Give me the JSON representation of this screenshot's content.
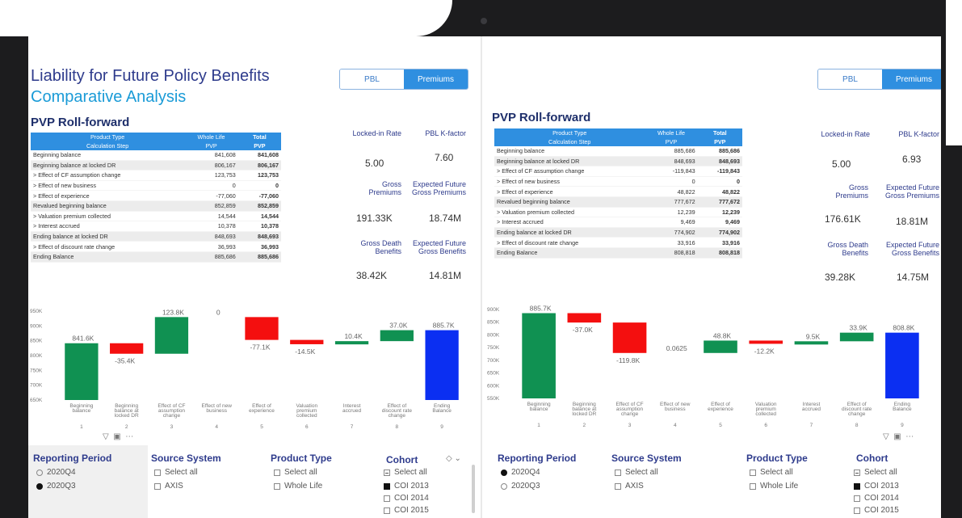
{
  "titles": {
    "main": "Liability for Future Policy Benefits",
    "sub": "Comparative Analysis",
    "section": "PVP Roll-forward"
  },
  "toggle": {
    "pbl": "PBL",
    "premiums": "Premiums"
  },
  "table_headers": {
    "product_type": "Product Type",
    "whole_life": "Whole Life",
    "total": "Total",
    "calc_step": "Calculation Step",
    "pvp": "PVP",
    "pvp_total": "PVP"
  },
  "left": {
    "rows": [
      {
        "label": "Beginning balance",
        "val": "841,608",
        "tot": "841,608"
      },
      {
        "label": "Beginning balance at locked DR",
        "val": "806,167",
        "tot": "806,167"
      },
      {
        "label": "> Effect of CF assumption change",
        "val": "123,753",
        "tot": "123,753"
      },
      {
        "label": "> Effect of new business",
        "val": "0",
        "tot": "0"
      },
      {
        "label": "> Effect of experience",
        "val": "-77,060",
        "tot": "-77,060"
      },
      {
        "label": "Revalued beginning balance",
        "val": "852,859",
        "tot": "852,859"
      },
      {
        "label": "> Valuation premium collected",
        "val": "14,544",
        "tot": "14,544"
      },
      {
        "label": "> Interest accrued",
        "val": "10,378",
        "tot": "10,378"
      },
      {
        "label": "Ending balance at locked DR",
        "val": "848,693",
        "tot": "848,693"
      },
      {
        "label": "> Effect of discount rate change",
        "val": "36,993",
        "tot": "36,993"
      },
      {
        "label": "Ending Balance",
        "val": "885,686",
        "tot": "885,686"
      }
    ],
    "kpis": {
      "locked_rate_label": "Locked-in Rate",
      "locked_rate": "5.00",
      "kfactor_label": "PBL K-factor",
      "kfactor": "7.60",
      "gross_prem_label": "Gross Premiums",
      "gross_prem": "191.33K",
      "exp_prem_label": "Expected Future Gross Premiums",
      "exp_prem": "18.74M",
      "gross_death_label": "Gross Death Benefits",
      "gross_death": "38.42K",
      "exp_ben_label": "Expected Future Gross Benefits",
      "exp_ben": "14.81M"
    },
    "filters": {
      "reporting_period": {
        "title": "Reporting Period",
        "options": [
          "2020Q4",
          "2020Q3"
        ]
      },
      "source_system": {
        "title": "Source System",
        "options": [
          "Select all",
          "AXIS"
        ]
      },
      "product_type": {
        "title": "Product Type",
        "options": [
          "Select all",
          "Whole Life"
        ]
      },
      "cohort": {
        "title": "Cohort",
        "options": [
          "Select all",
          "COI 2013",
          "COI 2014",
          "COI 2015"
        ]
      }
    }
  },
  "right": {
    "rows": [
      {
        "label": "Beginning balance",
        "val": "885,686",
        "tot": "885,686"
      },
      {
        "label": "Beginning balance at locked DR",
        "val": "848,693",
        "tot": "848,693"
      },
      {
        "label": "> Effect of CF assumption change",
        "val": "-119,843",
        "tot": "-119,843"
      },
      {
        "label": "> Effect of new business",
        "val": "0",
        "tot": "0"
      },
      {
        "label": "> Effect of experience",
        "val": "48,822",
        "tot": "48,822"
      },
      {
        "label": "Revalued beginning balance",
        "val": "777,672",
        "tot": "777,672"
      },
      {
        "label": "> Valuation premium collected",
        "val": "12,239",
        "tot": "12,239"
      },
      {
        "label": "> Interest accrued",
        "val": "9,469",
        "tot": "9,469"
      },
      {
        "label": "Ending balance at locked DR",
        "val": "774,902",
        "tot": "774,902"
      },
      {
        "label": "> Effect of discount rate change",
        "val": "33,916",
        "tot": "33,916"
      },
      {
        "label": "Ending Balance",
        "val": "808,818",
        "tot": "808,818"
      }
    ],
    "kpis": {
      "locked_rate_label": "Locked-in Rate",
      "locked_rate": "5.00",
      "kfactor_label": "PBL K-factor",
      "kfactor": "6.93",
      "gross_prem_label": "Gross Premiums",
      "gross_prem": "176.61K",
      "exp_prem_label": "Expected Future Gross Premiums",
      "exp_prem": "18.81M",
      "gross_death_label": "Gross Death Benefits",
      "gross_death": "39.28K",
      "exp_ben_label": "Expected Future Gross Benefits",
      "exp_ben": "14.75M"
    },
    "filters": {
      "reporting_period": {
        "title": "Reporting Period",
        "options": [
          "2020Q4",
          "2020Q3"
        ]
      },
      "source_system": {
        "title": "Source System",
        "options": [
          "Select all",
          "AXIS"
        ]
      },
      "product_type": {
        "title": "Product Type",
        "options": [
          "Select all",
          "Whole Life"
        ]
      },
      "cohort": {
        "title": "Cohort",
        "options": [
          "Select all",
          "COI 2013",
          "COI 2014",
          "COI 2015"
        ]
      }
    }
  },
  "colors": {
    "green": "#109152",
    "red": "#f40f0f",
    "blue": "#0b2ff2",
    "header": "#2f8fe0",
    "title": "#2e3b8c",
    "accent": "#1a9bd7"
  },
  "chart_data": [
    {
      "type": "bar",
      "title": "",
      "categories": [
        "Beginning balance",
        "Beginning balance at locked DR",
        "Effect of CF assumption change",
        "Effect of new business",
        "Effect of experience",
        "Valuation premium collected",
        "Interest accrued",
        "Effect of discount rate change",
        "Ending Balance"
      ],
      "tick_numbers": [
        "1",
        "2",
        "3",
        "4",
        "5",
        "6",
        "7",
        "8",
        "9"
      ],
      "y_ticks": [
        "950K",
        "900K",
        "850K",
        "800K",
        "750K",
        "700K",
        "650K"
      ],
      "ylim": [
        650000,
        950000
      ],
      "bars": [
        {
          "start": 650000,
          "end": 841608,
          "label": "841.6K",
          "color": "green"
        },
        {
          "start": 841608,
          "end": 806167,
          "label": "-35.4K",
          "color": "red"
        },
        {
          "start": 806167,
          "end": 929920,
          "label": "123.8K",
          "color": "green"
        },
        {
          "start": 929920,
          "end": 929920,
          "label": "0",
          "color": "none"
        },
        {
          "start": 929920,
          "end": 852859,
          "label": "-77.1K",
          "color": "red"
        },
        {
          "start": 852859,
          "end": 838315,
          "label": "-14.5K",
          "color": "red"
        },
        {
          "start": 838315,
          "end": 848693,
          "label": "10.4K",
          "color": "green"
        },
        {
          "start": 848693,
          "end": 885686,
          "label": "37.0K",
          "color": "green"
        },
        {
          "start": 650000,
          "end": 885686,
          "label": "885.7K",
          "color": "blue"
        }
      ]
    },
    {
      "type": "bar",
      "title": "",
      "categories": [
        "Beginning balance",
        "Beginning balance at locked DR",
        "Effect of CF assumption change",
        "Effect of new business",
        "Effect of experience",
        "Valuation premium collected",
        "Interest accrued",
        "Effect of discount rate change",
        "Ending Balance"
      ],
      "tick_numbers": [
        "1",
        "2",
        "3",
        "4",
        "5",
        "6",
        "7",
        "8",
        "9"
      ],
      "y_ticks": [
        "900K",
        "850K",
        "800K",
        "750K",
        "700K",
        "650K",
        "600K",
        "550K"
      ],
      "ylim": [
        550000,
        900000
      ],
      "bars": [
        {
          "start": 550000,
          "end": 885686,
          "label": "885.7K",
          "color": "green"
        },
        {
          "start": 885686,
          "end": 848693,
          "label": "-37.0K",
          "color": "red"
        },
        {
          "start": 848693,
          "end": 728850,
          "label": "-119.8K",
          "color": "red"
        },
        {
          "start": 728850,
          "end": 728850,
          "label": "0.0625",
          "color": "none"
        },
        {
          "start": 728850,
          "end": 777672,
          "label": "48.8K",
          "color": "green"
        },
        {
          "start": 777672,
          "end": 765433,
          "label": "-12.2K",
          "color": "red"
        },
        {
          "start": 765433,
          "end": 774902,
          "label": "9.5K",
          "color": "green"
        },
        {
          "start": 774902,
          "end": 808818,
          "label": "33.9K",
          "color": "green"
        },
        {
          "start": 550000,
          "end": 808818,
          "label": "808.8K",
          "color": "blue"
        }
      ]
    }
  ]
}
